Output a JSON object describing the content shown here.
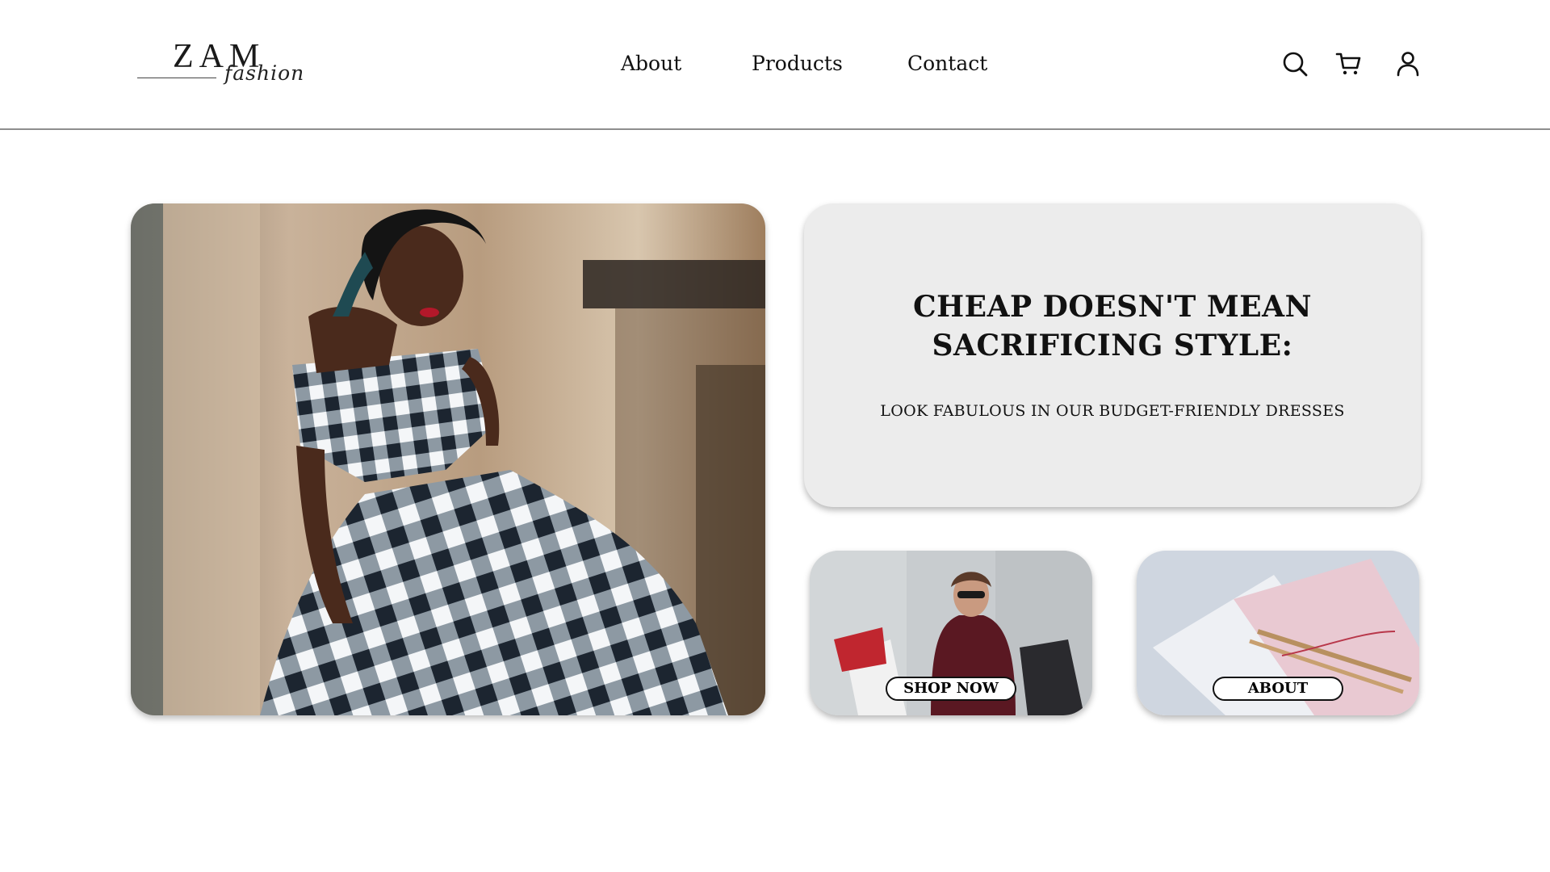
{
  "brand": {
    "logo_main": "ZAM",
    "logo_sub": "fashion"
  },
  "nav": {
    "items": [
      {
        "label": "About"
      },
      {
        "label": "Products"
      },
      {
        "label": "Contact"
      }
    ]
  },
  "header_icons": [
    "search-icon",
    "cart-icon",
    "user-icon"
  ],
  "promo": {
    "title_line1": "CHEAP DOESN'T MEAN",
    "title_line2": "SACRIFICING STYLE:",
    "subtitle": "LOOK FABULOUS IN OUR BUDGET-FRIENDLY DRESSES"
  },
  "cards": {
    "shop_label": "SHOP NOW",
    "about_label": "ABOUT"
  },
  "colors": {
    "promo_bg": "#ececec",
    "header_rule": "#8e8e8e",
    "text": "#111111"
  }
}
